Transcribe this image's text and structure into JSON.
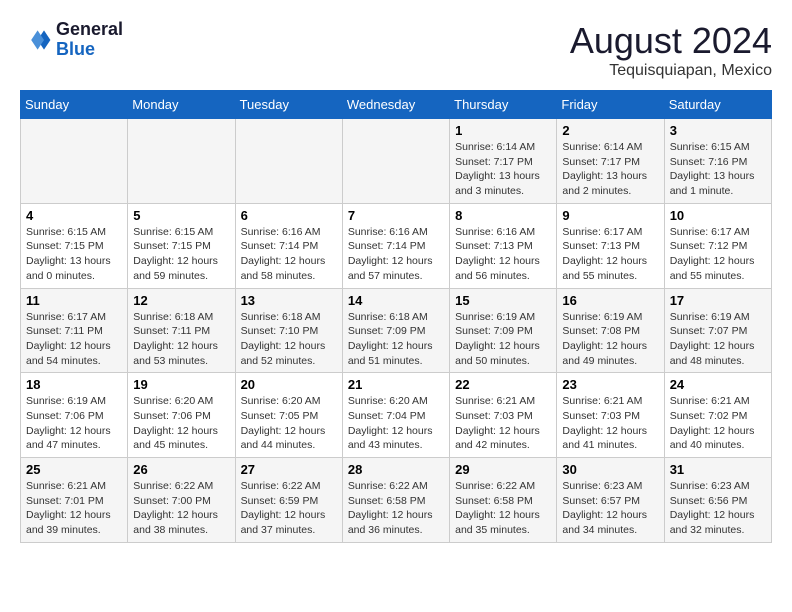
{
  "header": {
    "logo_line1": "General",
    "logo_line2": "Blue",
    "month_year": "August 2024",
    "location": "Tequisquiapan, Mexico"
  },
  "weekdays": [
    "Sunday",
    "Monday",
    "Tuesday",
    "Wednesday",
    "Thursday",
    "Friday",
    "Saturday"
  ],
  "weeks": [
    [
      {
        "day": "",
        "info": ""
      },
      {
        "day": "",
        "info": ""
      },
      {
        "day": "",
        "info": ""
      },
      {
        "day": "",
        "info": ""
      },
      {
        "day": "1",
        "info": "Sunrise: 6:14 AM\nSunset: 7:17 PM\nDaylight: 13 hours\nand 3 minutes."
      },
      {
        "day": "2",
        "info": "Sunrise: 6:14 AM\nSunset: 7:17 PM\nDaylight: 13 hours\nand 2 minutes."
      },
      {
        "day": "3",
        "info": "Sunrise: 6:15 AM\nSunset: 7:16 PM\nDaylight: 13 hours\nand 1 minute."
      }
    ],
    [
      {
        "day": "4",
        "info": "Sunrise: 6:15 AM\nSunset: 7:15 PM\nDaylight: 13 hours\nand 0 minutes."
      },
      {
        "day": "5",
        "info": "Sunrise: 6:15 AM\nSunset: 7:15 PM\nDaylight: 12 hours\nand 59 minutes."
      },
      {
        "day": "6",
        "info": "Sunrise: 6:16 AM\nSunset: 7:14 PM\nDaylight: 12 hours\nand 58 minutes."
      },
      {
        "day": "7",
        "info": "Sunrise: 6:16 AM\nSunset: 7:14 PM\nDaylight: 12 hours\nand 57 minutes."
      },
      {
        "day": "8",
        "info": "Sunrise: 6:16 AM\nSunset: 7:13 PM\nDaylight: 12 hours\nand 56 minutes."
      },
      {
        "day": "9",
        "info": "Sunrise: 6:17 AM\nSunset: 7:13 PM\nDaylight: 12 hours\nand 55 minutes."
      },
      {
        "day": "10",
        "info": "Sunrise: 6:17 AM\nSunset: 7:12 PM\nDaylight: 12 hours\nand 55 minutes."
      }
    ],
    [
      {
        "day": "11",
        "info": "Sunrise: 6:17 AM\nSunset: 7:11 PM\nDaylight: 12 hours\nand 54 minutes."
      },
      {
        "day": "12",
        "info": "Sunrise: 6:18 AM\nSunset: 7:11 PM\nDaylight: 12 hours\nand 53 minutes."
      },
      {
        "day": "13",
        "info": "Sunrise: 6:18 AM\nSunset: 7:10 PM\nDaylight: 12 hours\nand 52 minutes."
      },
      {
        "day": "14",
        "info": "Sunrise: 6:18 AM\nSunset: 7:09 PM\nDaylight: 12 hours\nand 51 minutes."
      },
      {
        "day": "15",
        "info": "Sunrise: 6:19 AM\nSunset: 7:09 PM\nDaylight: 12 hours\nand 50 minutes."
      },
      {
        "day": "16",
        "info": "Sunrise: 6:19 AM\nSunset: 7:08 PM\nDaylight: 12 hours\nand 49 minutes."
      },
      {
        "day": "17",
        "info": "Sunrise: 6:19 AM\nSunset: 7:07 PM\nDaylight: 12 hours\nand 48 minutes."
      }
    ],
    [
      {
        "day": "18",
        "info": "Sunrise: 6:19 AM\nSunset: 7:06 PM\nDaylight: 12 hours\nand 47 minutes."
      },
      {
        "day": "19",
        "info": "Sunrise: 6:20 AM\nSunset: 7:06 PM\nDaylight: 12 hours\nand 45 minutes."
      },
      {
        "day": "20",
        "info": "Sunrise: 6:20 AM\nSunset: 7:05 PM\nDaylight: 12 hours\nand 44 minutes."
      },
      {
        "day": "21",
        "info": "Sunrise: 6:20 AM\nSunset: 7:04 PM\nDaylight: 12 hours\nand 43 minutes."
      },
      {
        "day": "22",
        "info": "Sunrise: 6:21 AM\nSunset: 7:03 PM\nDaylight: 12 hours\nand 42 minutes."
      },
      {
        "day": "23",
        "info": "Sunrise: 6:21 AM\nSunset: 7:03 PM\nDaylight: 12 hours\nand 41 minutes."
      },
      {
        "day": "24",
        "info": "Sunrise: 6:21 AM\nSunset: 7:02 PM\nDaylight: 12 hours\nand 40 minutes."
      }
    ],
    [
      {
        "day": "25",
        "info": "Sunrise: 6:21 AM\nSunset: 7:01 PM\nDaylight: 12 hours\nand 39 minutes."
      },
      {
        "day": "26",
        "info": "Sunrise: 6:22 AM\nSunset: 7:00 PM\nDaylight: 12 hours\nand 38 minutes."
      },
      {
        "day": "27",
        "info": "Sunrise: 6:22 AM\nSunset: 6:59 PM\nDaylight: 12 hours\nand 37 minutes."
      },
      {
        "day": "28",
        "info": "Sunrise: 6:22 AM\nSunset: 6:58 PM\nDaylight: 12 hours\nand 36 minutes."
      },
      {
        "day": "29",
        "info": "Sunrise: 6:22 AM\nSunset: 6:58 PM\nDaylight: 12 hours\nand 35 minutes."
      },
      {
        "day": "30",
        "info": "Sunrise: 6:23 AM\nSunset: 6:57 PM\nDaylight: 12 hours\nand 34 minutes."
      },
      {
        "day": "31",
        "info": "Sunrise: 6:23 AM\nSunset: 6:56 PM\nDaylight: 12 hours\nand 32 minutes."
      }
    ]
  ]
}
